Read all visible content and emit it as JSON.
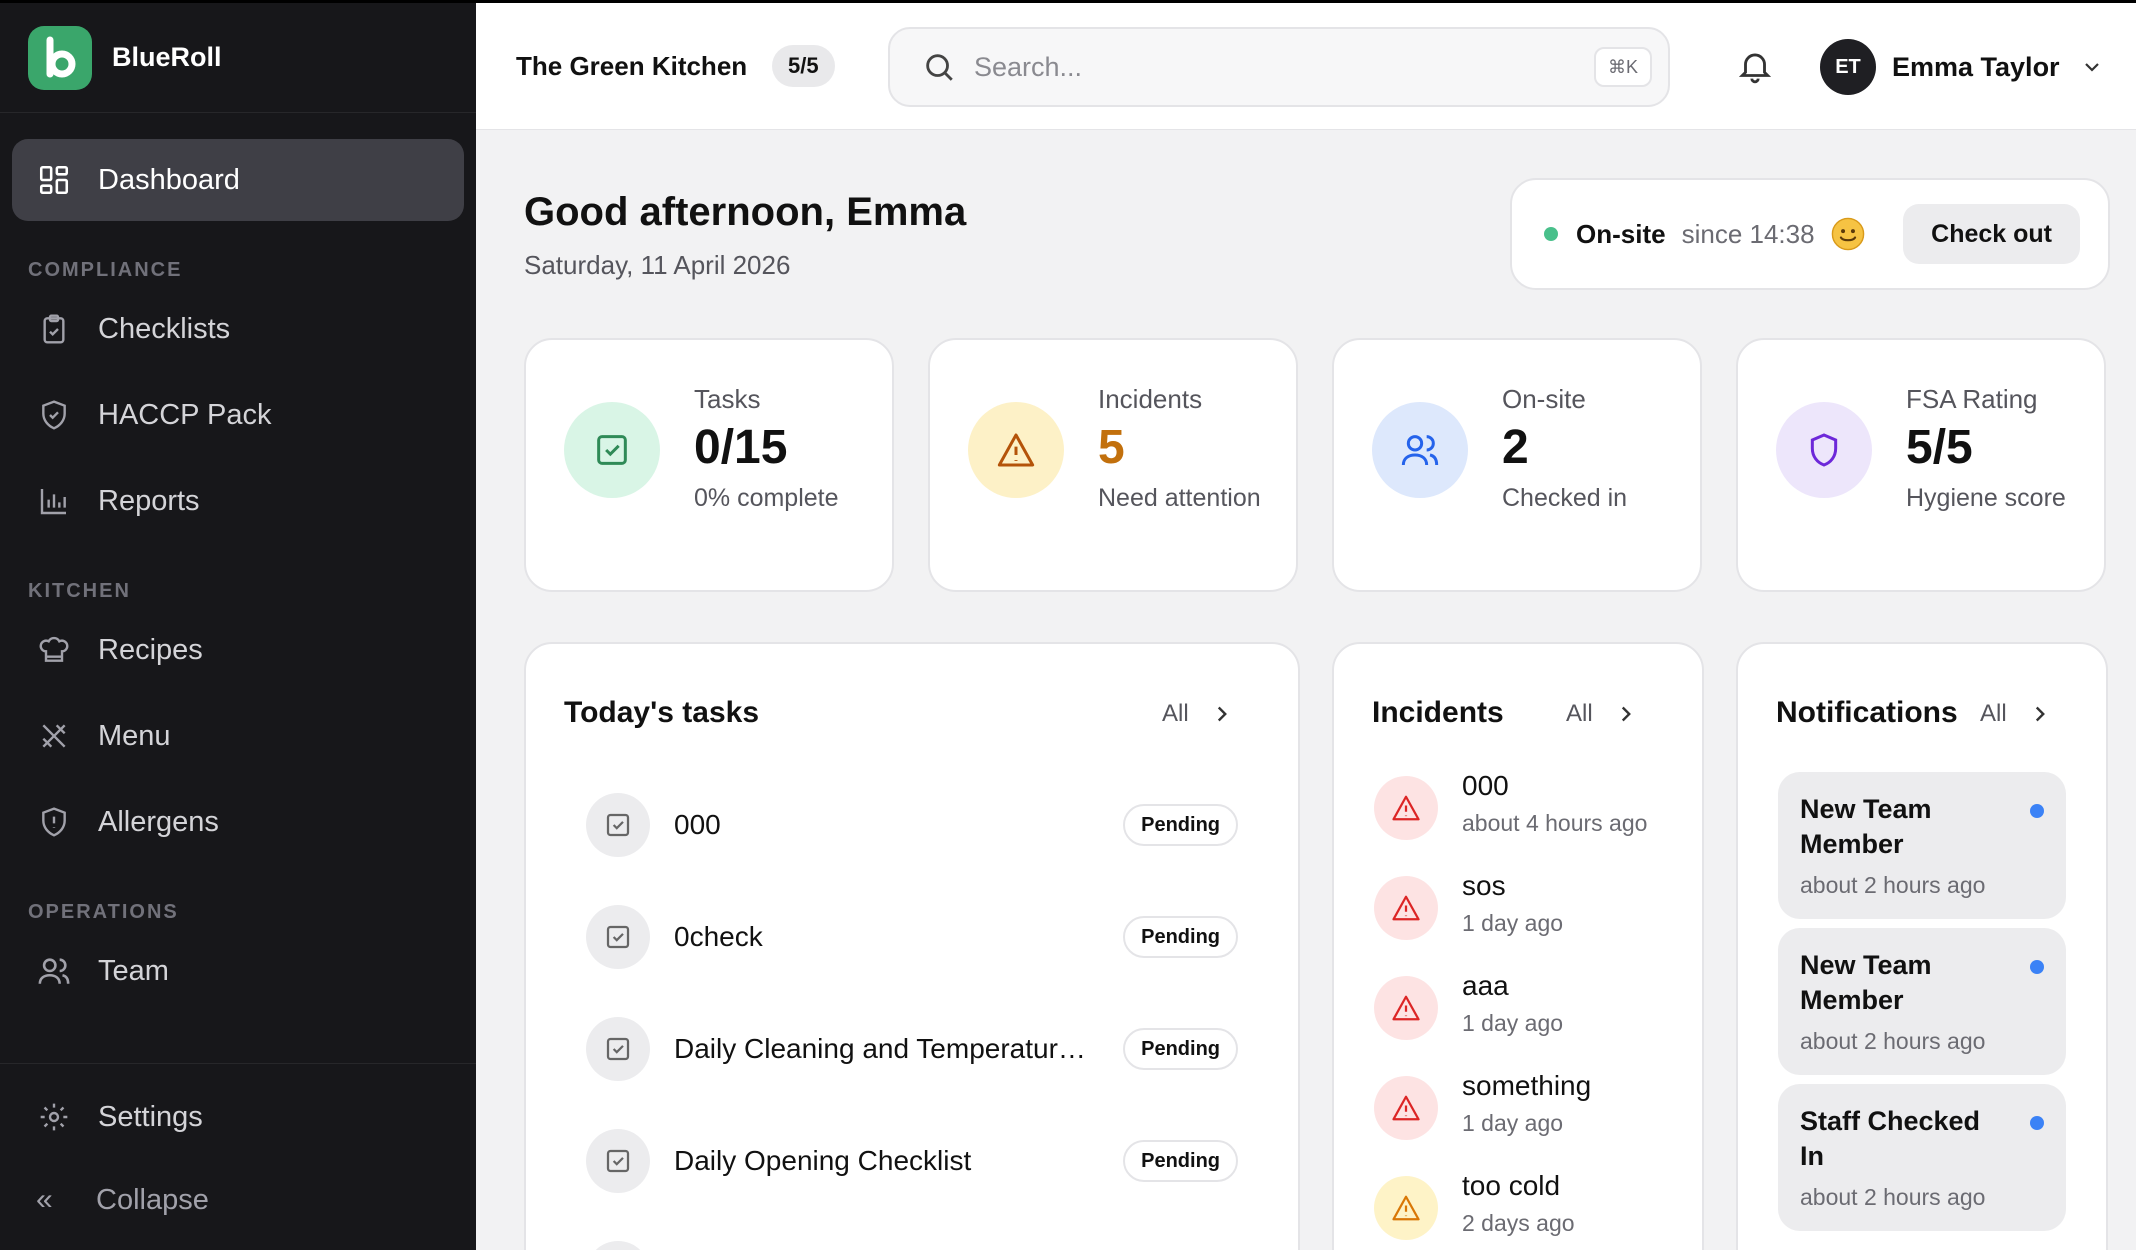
{
  "brand": {
    "name": "BlueRoll",
    "logo_letter": "b",
    "accent": "#3aa66b"
  },
  "sidebar": {
    "primary": {
      "label": "Dashboard",
      "icon": "dashboard-icon"
    },
    "sections": [
      {
        "title": "COMPLIANCE",
        "items": [
          {
            "label": "Checklists",
            "icon": "clipboard-check-icon"
          },
          {
            "label": "HACCP Pack",
            "icon": "shield-check-icon"
          },
          {
            "label": "Reports",
            "icon": "bar-chart-icon"
          }
        ]
      },
      {
        "title": "KITCHEN",
        "items": [
          {
            "label": "Recipes",
            "icon": "chef-hat-icon"
          },
          {
            "label": "Menu",
            "icon": "utensils-crossed-icon"
          },
          {
            "label": "Allergens",
            "icon": "shield-alert-icon"
          }
        ]
      },
      {
        "title": "OPERATIONS",
        "items": [
          {
            "label": "Team",
            "icon": "users-icon"
          }
        ]
      }
    ],
    "settings_label": "Settings",
    "collapse_label": "Collapse"
  },
  "topbar": {
    "org_name": "The Green Kitchen",
    "org_badge": "5/5",
    "search_placeholder": "Search...",
    "search_shortcut": "⌘K",
    "user_initials": "ET",
    "user_name": "Emma Taylor"
  },
  "header": {
    "greeting": "Good afternoon, Emma",
    "date": "Saturday, 11 April 2026"
  },
  "status": {
    "label": "On-site",
    "since": "since 14:38",
    "checkout_label": "Check out",
    "dot_color": "#49c08b"
  },
  "stats": [
    {
      "label": "Tasks",
      "value": "0/15",
      "sub": "0% complete",
      "icon": "clipboard-check-icon",
      "value_color": "#111111",
      "icon_bg": "#d9f5e6",
      "icon_color": "#2f8a57"
    },
    {
      "label": "Incidents",
      "value": "5",
      "sub": "Need attention",
      "icon": "warning-icon",
      "value_color": "#c2700c",
      "icon_bg": "#fdf1c7",
      "icon_color": "#b45309"
    },
    {
      "label": "On-site",
      "value": "2",
      "sub": "Checked in",
      "icon": "users-icon",
      "value_color": "#111111",
      "icon_bg": "#dde8fc",
      "icon_color": "#2563eb"
    },
    {
      "label": "FSA Rating",
      "value": "5/5",
      "sub": "Hygiene score",
      "icon": "shield-icon",
      "value_color": "#111111",
      "icon_bg": "#ede6fb",
      "icon_color": "#6d28d9"
    }
  ],
  "tasks_panel": {
    "title": "Today's tasks",
    "all_label": "All",
    "items": [
      {
        "name": "000",
        "status": "Pending"
      },
      {
        "name": "0check",
        "status": "Pending"
      },
      {
        "name": "Daily Cleaning and Temperature Checks",
        "status": "Pending"
      },
      {
        "name": "Daily Opening Checklist",
        "status": "Pending"
      }
    ]
  },
  "incidents_panel": {
    "title": "Incidents",
    "all_label": "All",
    "items": [
      {
        "name": "000",
        "time": "about 4 hours ago",
        "severity": "red"
      },
      {
        "name": "sos",
        "time": "1 day ago",
        "severity": "red"
      },
      {
        "name": "aaa",
        "time": "1 day ago",
        "severity": "red"
      },
      {
        "name": "something",
        "time": "1 day ago",
        "severity": "red"
      },
      {
        "name": "too cold",
        "time": "2 days ago",
        "severity": "yellow"
      }
    ]
  },
  "notifications_panel": {
    "title": "Notifications",
    "all_label": "All",
    "items": [
      {
        "title": "New Team Member",
        "time": "about 2 hours ago",
        "unread": true
      },
      {
        "title": "New Team Member",
        "time": "about 2 hours ago",
        "unread": true
      },
      {
        "title": "Staff Checked In",
        "time": "about 2 hours ago",
        "unread": true
      }
    ]
  }
}
